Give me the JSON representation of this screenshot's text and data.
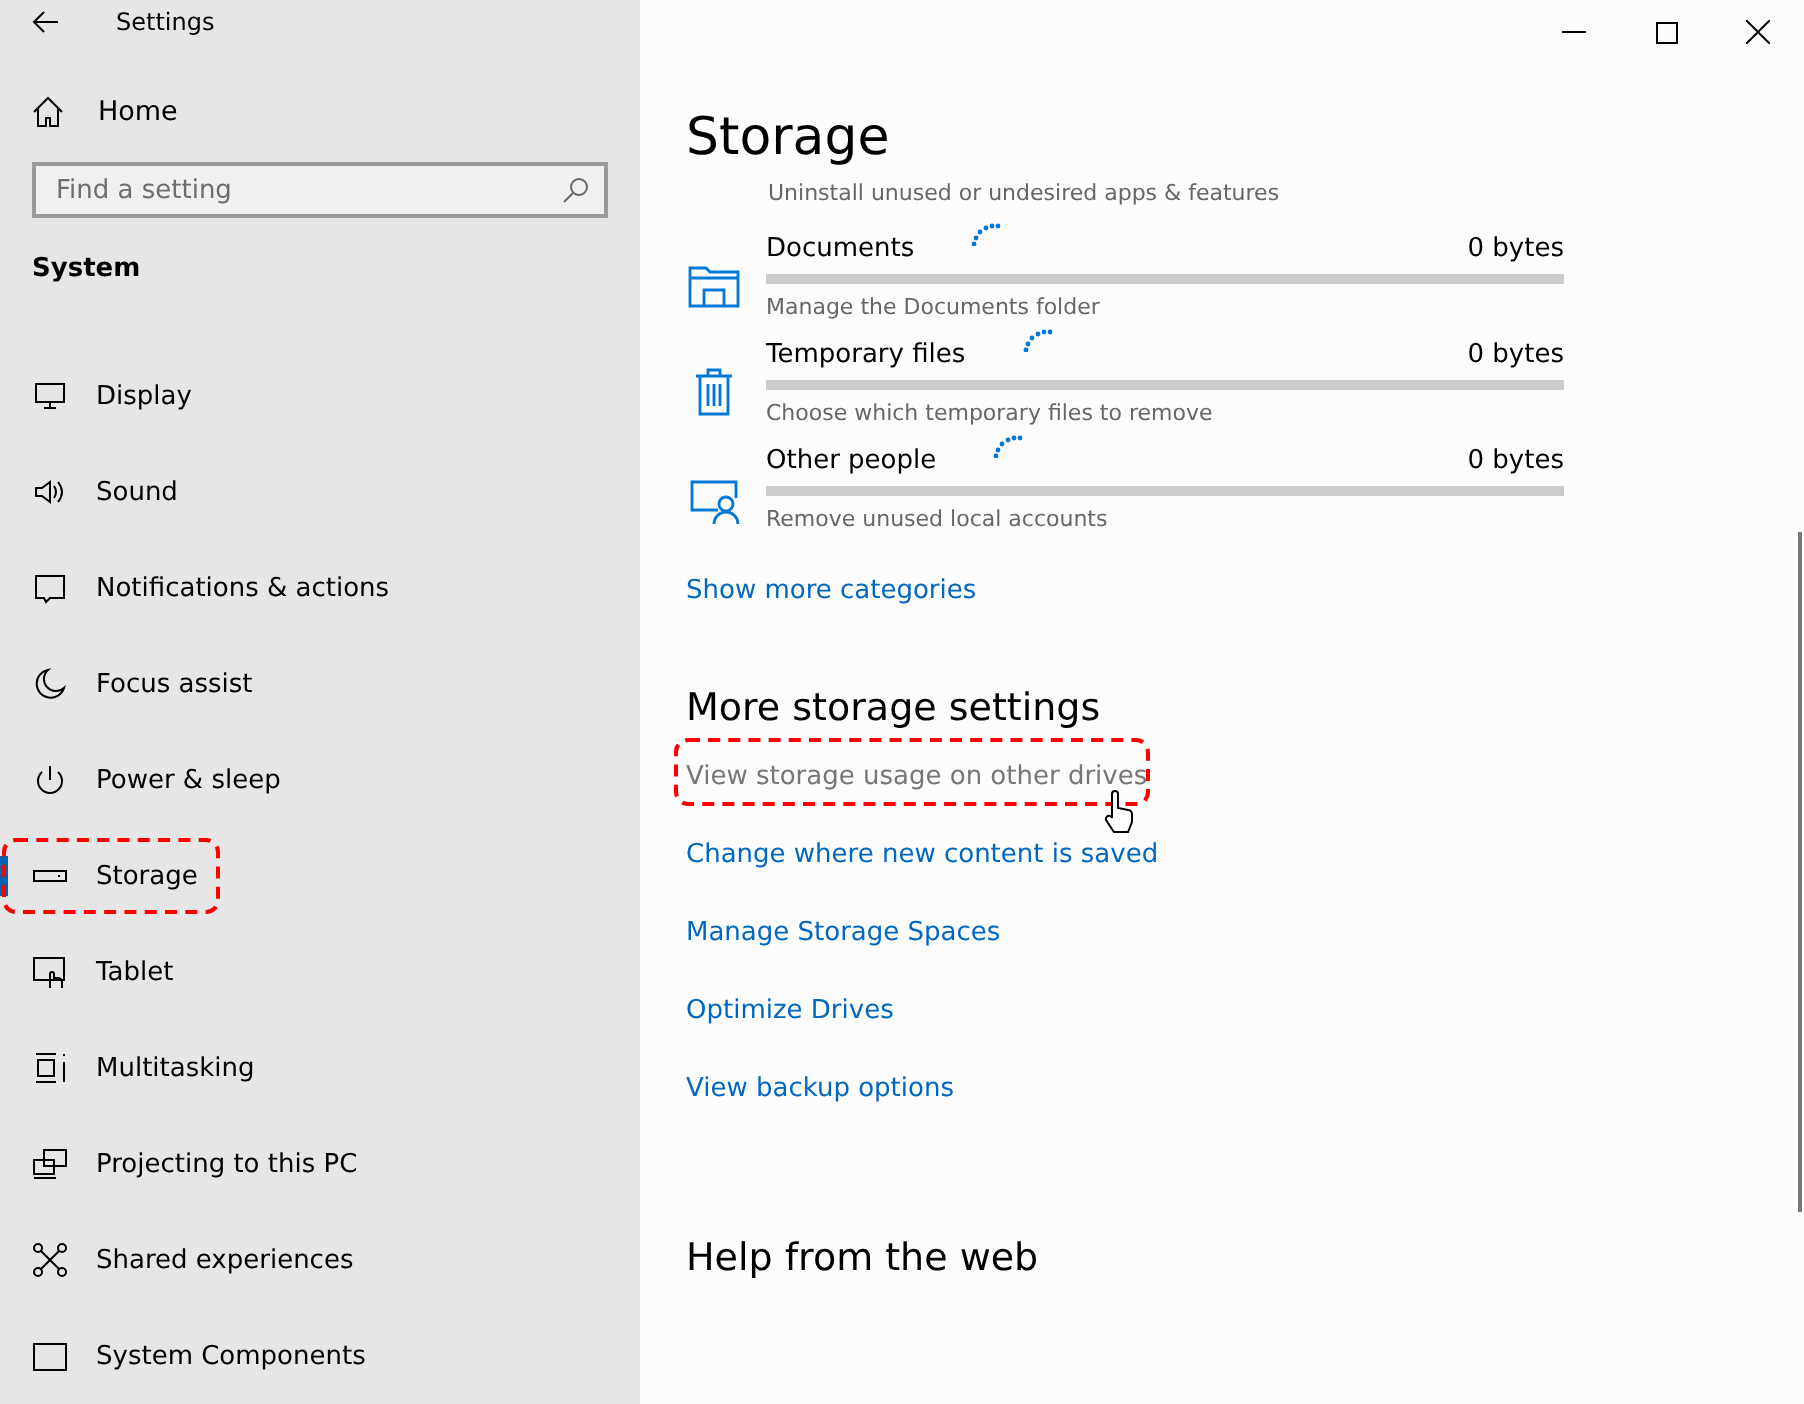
{
  "window": {
    "title": "Settings"
  },
  "sidebar": {
    "home": "Home",
    "search": {
      "placeholder": "Find a setting"
    },
    "section": "System",
    "items": [
      {
        "label": "Display",
        "selected": false,
        "highlighted": false
      },
      {
        "label": "Sound",
        "selected": false,
        "highlighted": false
      },
      {
        "label": "Notifications & actions",
        "selected": false,
        "highlighted": false
      },
      {
        "label": "Focus assist",
        "selected": false,
        "highlighted": false
      },
      {
        "label": "Power & sleep",
        "selected": false,
        "highlighted": false
      },
      {
        "label": "Storage",
        "selected": true,
        "highlighted": true
      },
      {
        "label": "Tablet",
        "selected": false,
        "highlighted": false
      },
      {
        "label": "Multitasking",
        "selected": false,
        "highlighted": false
      },
      {
        "label": "Projecting to this PC",
        "selected": false,
        "highlighted": false
      },
      {
        "label": "Shared experiences",
        "selected": false,
        "highlighted": false
      },
      {
        "label": "System Components",
        "selected": false,
        "highlighted": false
      }
    ]
  },
  "main": {
    "title": "Storage",
    "top_caption": "Uninstall unused or undesired apps & features",
    "categories": [
      {
        "name": "Documents",
        "size": "0 bytes",
        "level": 0,
        "caption": "Manage the Documents folder"
      },
      {
        "name": "Temporary files",
        "size": "0 bytes",
        "level": 0,
        "caption": "Choose which temporary files to remove"
      },
      {
        "name": "Other people",
        "size": "0 bytes",
        "level": 0,
        "caption": "Remove unused local accounts"
      }
    ],
    "show_more": "Show more categories",
    "more_heading": "More storage settings",
    "links": [
      {
        "label": "View storage usage on other drives",
        "hovered": true,
        "highlighted": true
      },
      {
        "label": "Change where new content is saved",
        "hovered": false,
        "highlighted": false
      },
      {
        "label": "Manage Storage Spaces",
        "hovered": false,
        "highlighted": false
      },
      {
        "label": "Optimize Drives",
        "hovered": false,
        "highlighted": false
      },
      {
        "label": "View backup options",
        "hovered": false,
        "highlighted": false
      }
    ],
    "help_heading": "Help from the web"
  }
}
